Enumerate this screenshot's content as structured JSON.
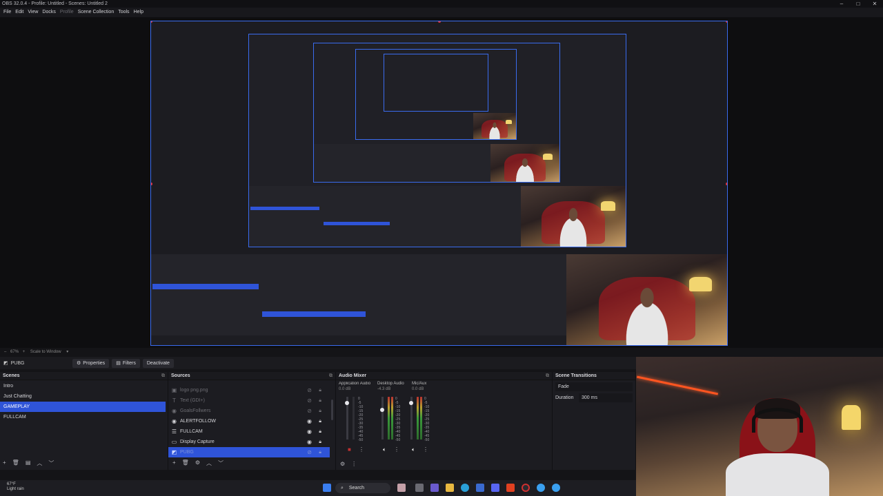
{
  "window": {
    "title": "OBS 32.0.4 - Profile: Untitled - Scenes: Untitled 2"
  },
  "menu": [
    "File",
    "Edit",
    "View",
    "Docks",
    "Profile",
    "Scene Collection",
    "Tools",
    "Help"
  ],
  "zoom_bar": {
    "zoom": "67%",
    "scale_mode": "Scale to Window"
  },
  "context_bar": {
    "source": "PUBG",
    "properties": "Properties",
    "filters": "Filters",
    "deactivate": "Deactivate"
  },
  "scenes": {
    "title": "Scenes",
    "items": [
      "Intro",
      "Just Chatting",
      "GAMEPLAY",
      "FULLCAM"
    ],
    "selected": "GAMEPLAY"
  },
  "sources": {
    "title": "Sources",
    "items": [
      {
        "name": "logo png.png",
        "icon": "image-icon",
        "visible": false
      },
      {
        "name": "Text (GDI+)",
        "icon": "text-icon",
        "visible": false
      },
      {
        "name": "GoalsFollwers",
        "icon": "browser-icon",
        "visible": false
      },
      {
        "name": "ALERTFOLLOW",
        "icon": "browser-icon",
        "visible": true
      },
      {
        "name": "FULLCAM",
        "icon": "scene-icon",
        "visible": true
      },
      {
        "name": "Display Capture",
        "icon": "display-icon",
        "visible": true
      },
      {
        "name": "PUBG",
        "icon": "game-capture-icon",
        "visible": false
      }
    ]
  },
  "audio_mixer": {
    "title": "Audio Mixer",
    "channels": [
      {
        "name": "Application Audio",
        "level": "0.0 dB"
      },
      {
        "name": "Desktop Audio",
        "level": "-4.3 dB"
      },
      {
        "name": "Mic/Aux",
        "level": "0.0 dB"
      }
    ],
    "scale": [
      "0",
      "-5",
      "-10",
      "-15",
      "-20",
      "-25",
      "-30",
      "-35",
      "-40",
      "-45",
      "-50",
      "-55",
      "-60"
    ]
  },
  "transitions": {
    "title": "Scene Transitions",
    "type": "Fade",
    "duration_label": "Duration",
    "duration": "300 ms"
  },
  "taskbar": {
    "temp": "67°F",
    "weather": "Light rain",
    "search": "Search"
  },
  "colors": {
    "accent": "#2f54d8",
    "selection_border": "#3a6cf0",
    "handle": "#e0303a"
  }
}
